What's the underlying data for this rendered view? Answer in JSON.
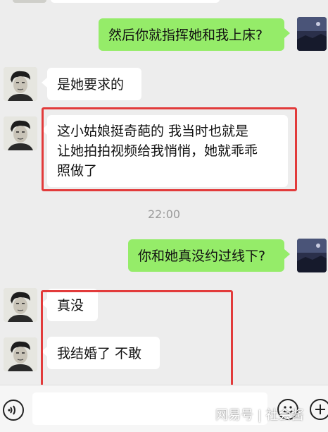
{
  "messages": [
    {
      "side": "out",
      "text": "然后你就指挥她和我上床?"
    },
    {
      "side": "in",
      "text": "是她要求的"
    },
    {
      "side": "in",
      "lines": [
        "这小姑娘挺奇葩的 我当时也就是",
        "让她拍拍视频给我悄悄，她就乖乖",
        "照做了"
      ]
    },
    {
      "side": "out",
      "text": "你和她真没约过线下?"
    },
    {
      "side": "in",
      "text": "真没"
    },
    {
      "side": "in",
      "text": "我结婚了 不敢"
    }
  ],
  "timestamp": "22:00",
  "watermark": "网易号 | 社会酱",
  "colors": {
    "background": "#ededed",
    "incoming_bubble": "#ffffff",
    "outgoing_bubble": "#95ec69",
    "highlight_box": "#e23b3b"
  },
  "icons": {
    "voice": "voice-icon",
    "emoji": "emoji-icon",
    "plus": "plus-icon"
  }
}
